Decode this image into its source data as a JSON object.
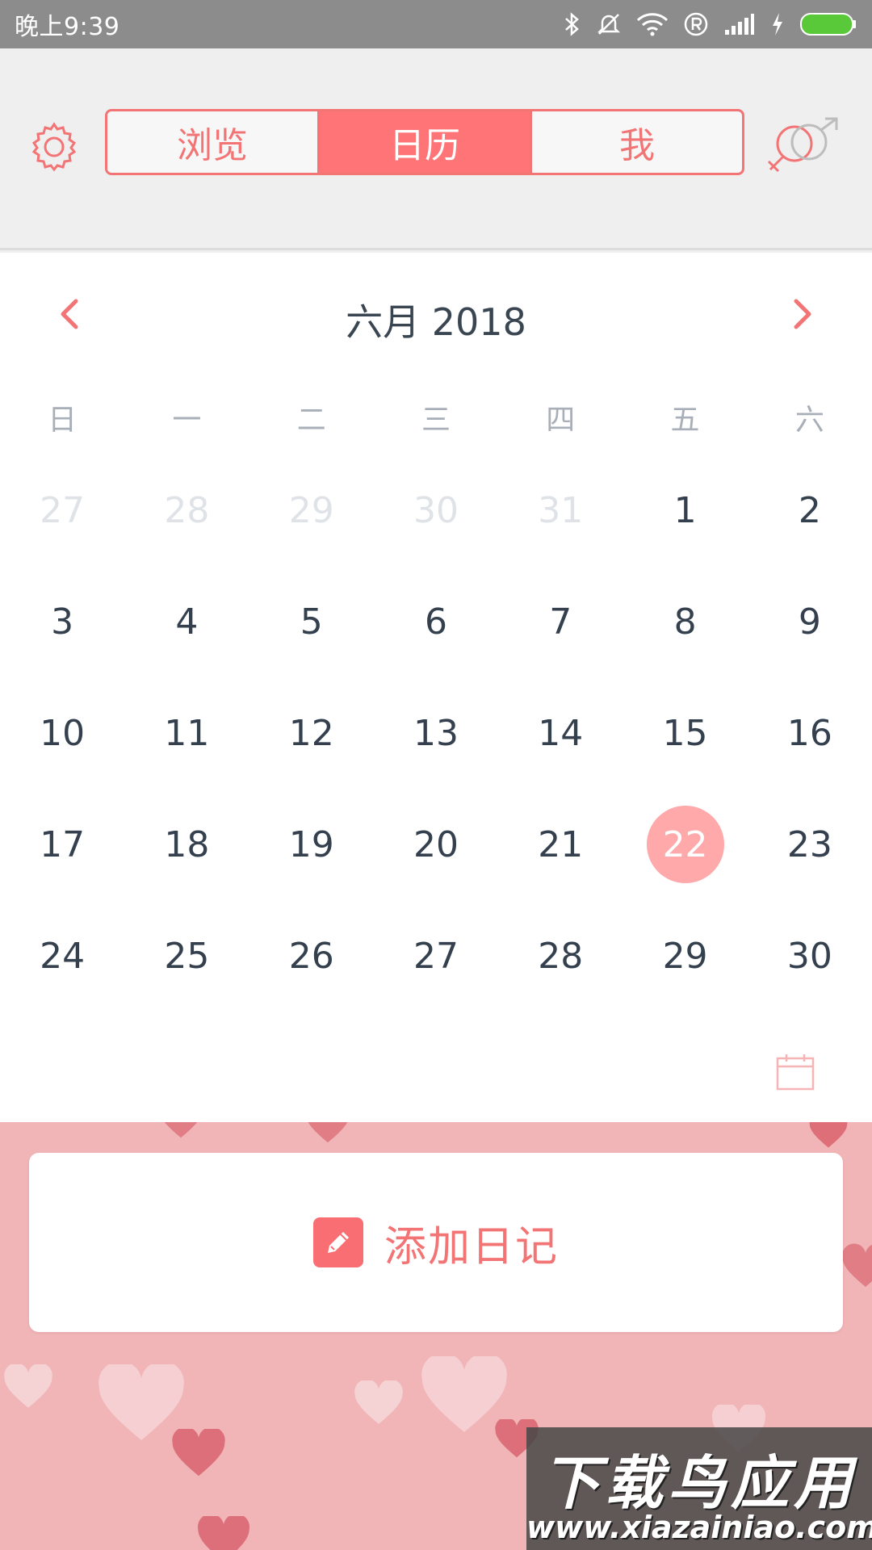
{
  "status_bar": {
    "time": "晚上9:39"
  },
  "header": {
    "tabs": [
      {
        "label": "浏览",
        "active": false
      },
      {
        "label": "日历",
        "active": true
      },
      {
        "label": "我",
        "active": false
      }
    ],
    "settings_icon": "gear-icon",
    "gender_icon": "gender-symbol-icon"
  },
  "calendar": {
    "month_title": "六月 2018",
    "weekdays": [
      "日",
      "一",
      "二",
      "三",
      "四",
      "五",
      "六"
    ],
    "weeks": [
      [
        "27",
        "28",
        "29",
        "30",
        "31",
        "1",
        "2"
      ],
      [
        "3",
        "4",
        "5",
        "6",
        "7",
        "8",
        "9"
      ],
      [
        "10",
        "11",
        "12",
        "13",
        "14",
        "15",
        "16"
      ],
      [
        "17",
        "18",
        "19",
        "20",
        "21",
        "22",
        "23"
      ],
      [
        "24",
        "25",
        "26",
        "27",
        "28",
        "29",
        "30"
      ]
    ],
    "selected_day": "22"
  },
  "diary": {
    "add_label": "添加日记"
  },
  "watermark": {
    "title": "下载鸟应用",
    "url": "www.xiazainiao.com"
  },
  "colors": {
    "accent": "#ff7476",
    "selected": "#ffa9ab",
    "bottom_bg": "#f1b4b7"
  }
}
